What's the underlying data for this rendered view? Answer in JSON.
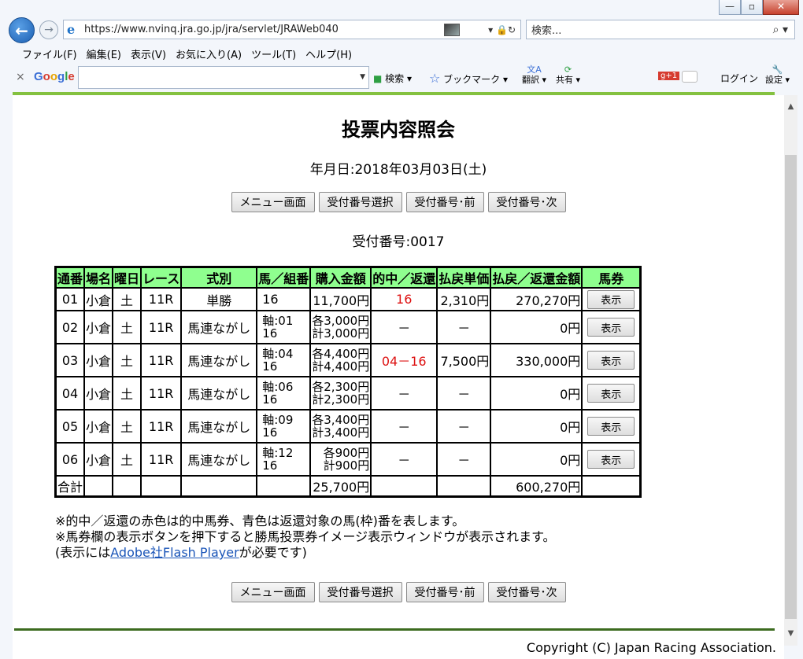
{
  "browser": {
    "url": "https://www.nvinq.jra.go.jp/jra/servlet/JRAWeb040",
    "search_placeholder": "検索...",
    "window_buttons": [
      "—",
      "▫",
      "✕"
    ],
    "menu": [
      "ファイル(F)",
      "編集(E)",
      "表示(V)",
      "お気に入り(A)",
      "ツール(T)",
      "ヘルプ(H)"
    ],
    "google_toolbar": {
      "logo": "Google",
      "search_label": "検索",
      "bookmark_label": "ブックマーク",
      "translate_label": "翻訳",
      "share_label": "共有",
      "gplus_label": "+1",
      "login_label": "ログイン",
      "settings_label": "設定"
    }
  },
  "page": {
    "title": "投票内容照会",
    "date_line": "年月日:2018年03月03日(土)",
    "receipt_line": "受付番号:0017",
    "nav_buttons": {
      "menu": "メニュー画面",
      "select": "受付番号選択",
      "prev": "受付番号･前",
      "next": "受付番号･次"
    },
    "table": {
      "headers": [
        "通番",
        "場名",
        "曜日",
        "レース",
        "式別",
        "馬／組番",
        "購入金額",
        "的中／返還",
        "払戻単価",
        "払戻／返還金額",
        "馬券"
      ],
      "rows": [
        {
          "no": "01",
          "place": "小倉",
          "day": "土",
          "race": "11R",
          "type": "単勝",
          "combo1": "16",
          "combo2": "",
          "amount1": "11,700円",
          "amount2": "",
          "hit": "16",
          "unit": "2,310円",
          "payout": "270,270円",
          "btn": "表示"
        },
        {
          "no": "02",
          "place": "小倉",
          "day": "土",
          "race": "11R",
          "type": "馬連ながし",
          "combo1": "軸:01",
          "combo2": "16",
          "amount1": "各3,000円",
          "amount2": "計3,000円",
          "hit": "－",
          "unit": "－",
          "payout": "0円",
          "btn": "表示"
        },
        {
          "no": "03",
          "place": "小倉",
          "day": "土",
          "race": "11R",
          "type": "馬連ながし",
          "combo1": "軸:04",
          "combo2": "16",
          "amount1": "各4,400円",
          "amount2": "計4,400円",
          "hit": "04－16",
          "unit": "7,500円",
          "payout": "330,000円",
          "btn": "表示"
        },
        {
          "no": "04",
          "place": "小倉",
          "day": "土",
          "race": "11R",
          "type": "馬連ながし",
          "combo1": "軸:06",
          "combo2": "16",
          "amount1": "各2,300円",
          "amount2": "計2,300円",
          "hit": "－",
          "unit": "－",
          "payout": "0円",
          "btn": "表示"
        },
        {
          "no": "05",
          "place": "小倉",
          "day": "土",
          "race": "11R",
          "type": "馬連ながし",
          "combo1": "軸:09",
          "combo2": "16",
          "amount1": "各3,400円",
          "amount2": "計3,400円",
          "hit": "－",
          "unit": "－",
          "payout": "0円",
          "btn": "表示"
        },
        {
          "no": "06",
          "place": "小倉",
          "day": "土",
          "race": "11R",
          "type": "馬連ながし",
          "combo1": "軸:12",
          "combo2": "16",
          "amount1": "各900円",
          "amount2": "計900円",
          "hit": "－",
          "unit": "－",
          "payout": "0円",
          "btn": "表示"
        }
      ],
      "total": {
        "label": "合計",
        "amount": "25,700円",
        "payout": "600,270円"
      }
    },
    "notes": {
      "line1": "※的中／返還の赤色は的中馬券、青色は返還対象の馬(枠)番を表します。",
      "line2": "※馬券欄の表示ボタンを押下すると勝馬投票券イメージ表示ウィンドウが表示されます。",
      "line3_prefix": "(表示には",
      "line3_link": "Adobe社Flash Player",
      "line3_suffix": "が必要です)"
    },
    "copyright": "Copyright (C) Japan Racing Association."
  },
  "colors": {
    "header_bg": "#8fff8f",
    "hit_red": "#dd1111",
    "accent_green": "#84c140",
    "footer_green": "#3c6b1f"
  }
}
